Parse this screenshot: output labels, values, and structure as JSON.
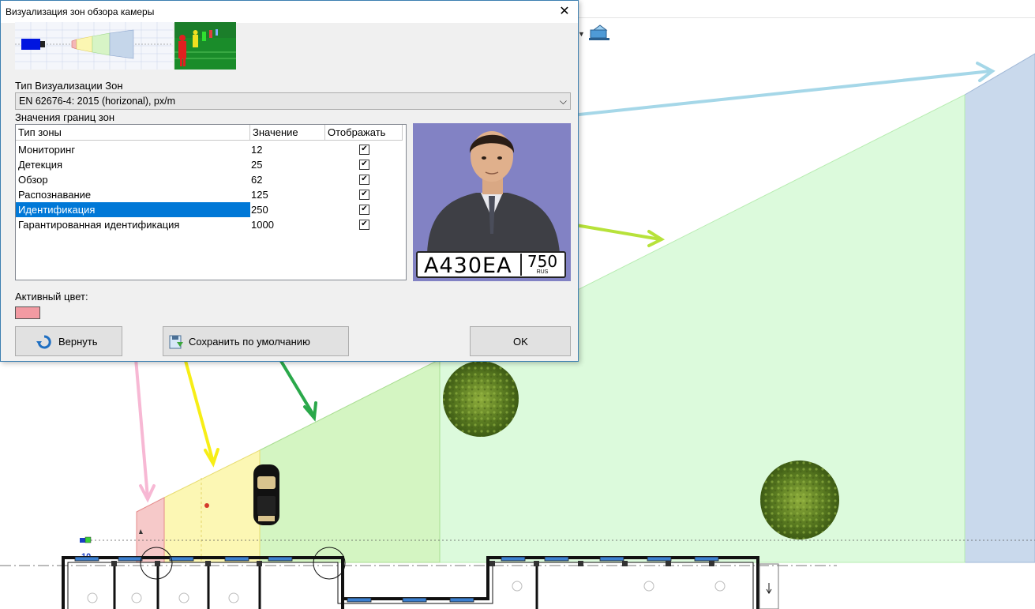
{
  "window": {
    "title": "Визуализация зон обзора камеры",
    "close_glyph": "✕"
  },
  "zone_type": {
    "label": "Тип Визуализации Зон",
    "selected": "EN 62676-4: 2015 (horizonal), px/m",
    "arrow_glyph": "⌵"
  },
  "table": {
    "label": "Значения границ зон",
    "headers": [
      "Тип зоны",
      "Значение",
      "Отображать"
    ],
    "rows": [
      {
        "name": "Мониторинг",
        "value": "12",
        "shown": true
      },
      {
        "name": "Детекция",
        "value": "25",
        "shown": true
      },
      {
        "name": "Обзор",
        "value": "62",
        "shown": true
      },
      {
        "name": "Распознавание",
        "value": "125",
        "shown": true
      },
      {
        "name": "Идентификация",
        "value": "250",
        "shown": true,
        "selected": true
      },
      {
        "name": "Гарантированная идентификация",
        "value": "1000",
        "shown": true
      }
    ]
  },
  "plate": {
    "main": "А430ЕА",
    "region": "750",
    "country": "RUS"
  },
  "active_color": {
    "label": "Активный цвет:",
    "value": "#f29aa2"
  },
  "buttons": {
    "revert": "Вернуть",
    "save_default": "Сохранить по умолчанию",
    "ok": "OK"
  },
  "floorplan": {
    "marker_label": "10"
  },
  "colors": {
    "monitoring": "#c8dced",
    "detection": "#d4f7d4",
    "observation": "#cdf0b8",
    "recognition": "#fbf5a8",
    "identification": "#f6c4c4",
    "selection": "#0078d7"
  }
}
